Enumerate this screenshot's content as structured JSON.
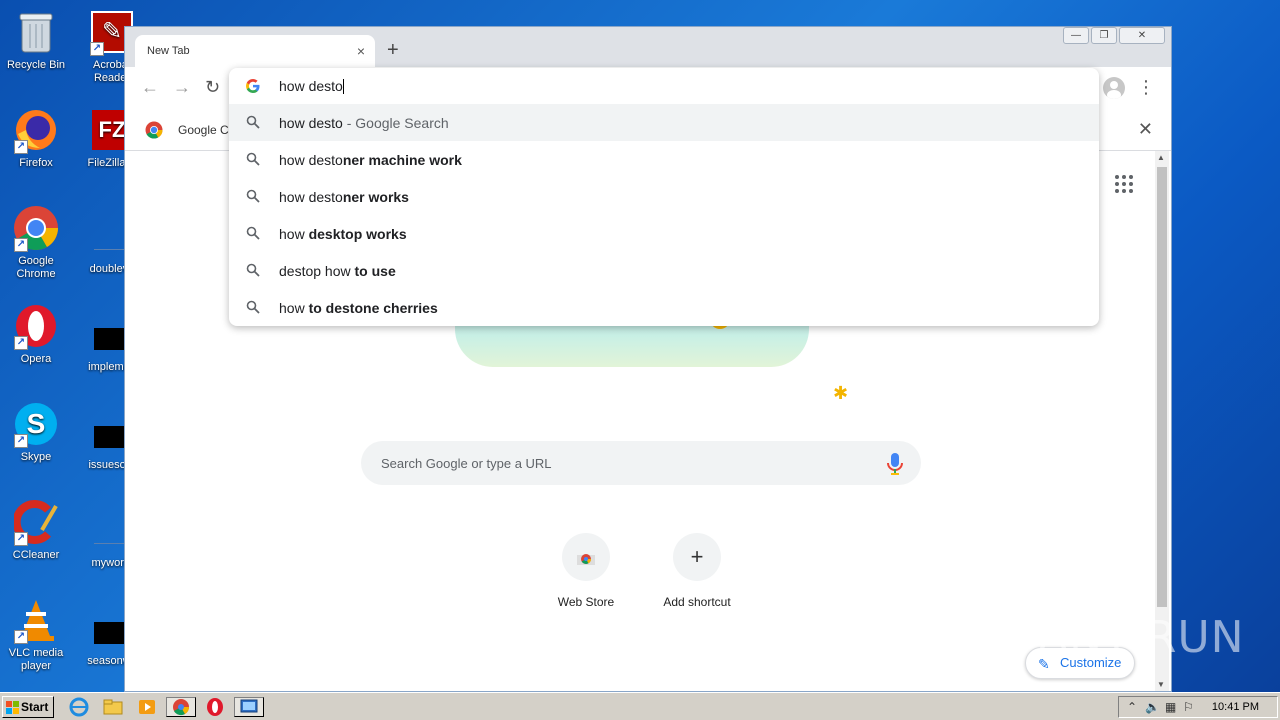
{
  "desktop": {
    "icons": [
      {
        "label": "Recycle Bin"
      },
      {
        "label": "Acrobat Reader"
      },
      {
        "label": "Firefox"
      },
      {
        "label": "FileZilla C"
      },
      {
        "label": "Google Chrome"
      },
      {
        "label": "doubleva"
      },
      {
        "label": "Opera"
      },
      {
        "label": "implemen"
      },
      {
        "label": "Skype"
      },
      {
        "label": "issuesord"
      },
      {
        "label": "CCleaner"
      },
      {
        "label": "mywork."
      },
      {
        "label": "VLC media player"
      },
      {
        "label": "seasonwh"
      }
    ]
  },
  "browser": {
    "tab_title": "New Tab",
    "tab_close": "×",
    "new_tab": "+",
    "infobar_text": "Google Cl",
    "omnibox": {
      "input_value": "how desto",
      "suggestions": [
        {
          "typed": "how desto",
          "rest": " - Google Search",
          "style": "search"
        },
        {
          "typed": "how desto",
          "rest": "ner machine work",
          "style": "bold"
        },
        {
          "typed": "how desto",
          "rest": "ner works",
          "style": "bold"
        },
        {
          "typed": "how ",
          "rest": "desktop works",
          "style": "bold"
        },
        {
          "typed": "destop how ",
          "rest": "to use",
          "style": "bold"
        },
        {
          "typed": "how ",
          "rest": "to destone cherries",
          "style": "mixed"
        }
      ]
    },
    "ntp": {
      "search_placeholder": "Search Google or type a URL",
      "shortcuts": [
        {
          "label": "Web Store"
        },
        {
          "label": "Add shortcut",
          "glyph": "+"
        }
      ],
      "customize": "Customize"
    }
  },
  "watermark": "ANY RUN",
  "taskbar": {
    "start": "Start",
    "clock": "10:41 PM"
  }
}
